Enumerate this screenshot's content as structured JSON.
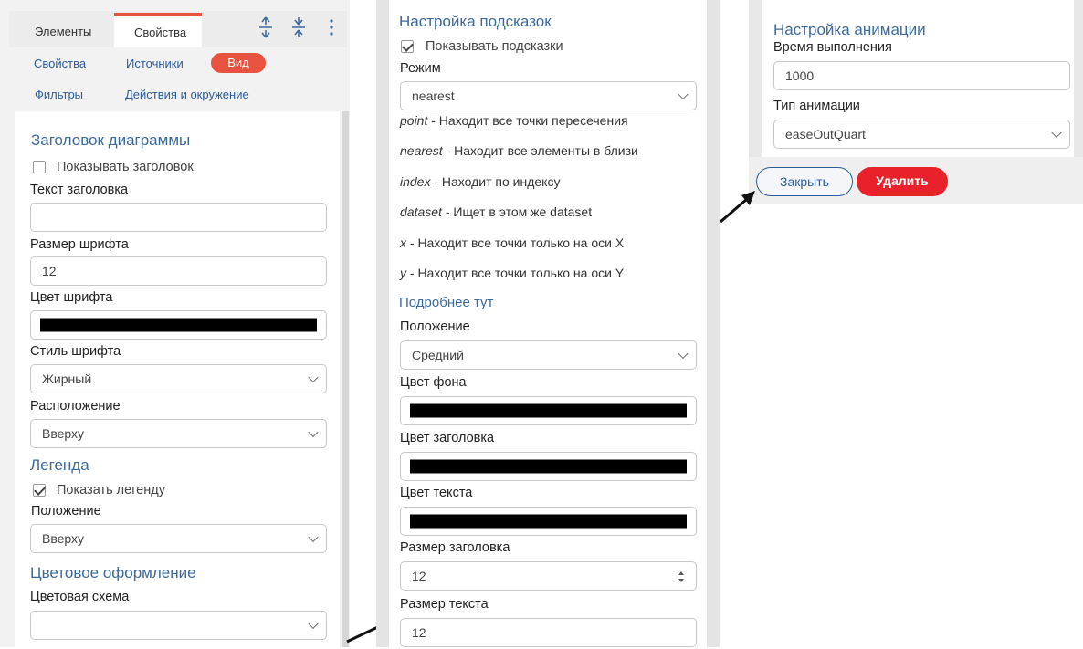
{
  "left_panel": {
    "tabs": [
      "Элементы",
      "Свойства"
    ],
    "subtabs": [
      "Свойства",
      "Источники",
      "Вид",
      "Фильтры",
      "Действия и окружение"
    ],
    "chart_title_section": "Заголовок диаграммы",
    "show_title_label": "Показывать заголовок",
    "show_title_checked": false,
    "title_text_label": "Текст заголовка",
    "title_text_value": "",
    "font_size_label": "Размер шрифта",
    "font_size_value": "12",
    "font_color_label": "Цвет шрифта",
    "font_color_value": "#000000",
    "font_style_label": "Стиль шрифта",
    "font_style_value": "Жирный",
    "position_label": "Расположение",
    "position_value": "Вверху",
    "legend_section": "Легенда",
    "show_legend_label": "Показать легенду",
    "show_legend_checked": true,
    "legend_position_label": "Положение",
    "legend_position_value": "Вверху",
    "color_section": "Цветовое оформление",
    "color_scheme_label": "Цветовая схема",
    "color_scheme_value": ""
  },
  "middle_panel": {
    "section": "Настройка подсказок",
    "show_tooltips_label": "Показывать подсказки",
    "show_tooltips_checked": true,
    "mode_label": "Режим",
    "mode_value": "nearest",
    "mode_desc": [
      {
        "key": "point",
        "text": " - Находит все точки пересечения"
      },
      {
        "key": "nearest",
        "text": " - Находит все элементы в близи"
      },
      {
        "key": "index",
        "text": " - Находит по индексу"
      },
      {
        "key": "dataset",
        "text": " - Ищет в этом же dataset"
      },
      {
        "key": "x",
        "text": " - Находит все точки только на оси X"
      },
      {
        "key": "y",
        "text": " - Находит все точки только на оси Y"
      }
    ],
    "more_link": "Подробнее тут",
    "position_label": "Положение",
    "position_value": "Средний",
    "bg_color_label": "Цвет фона",
    "title_color_label": "Цвет заголовка",
    "text_color_label": "Цвет текста",
    "title_size_label": "Размер заголовка",
    "title_size_value": "12",
    "text_size_label": "Размер текста",
    "text_size_value": "12"
  },
  "right_panel": {
    "section": "Настройка анимации",
    "duration_label": "Время выполнения",
    "duration_value": "1000",
    "anim_type_label": "Тип анимации",
    "anim_type_value": "easeOutQuart",
    "close_label": "Закрыть",
    "delete_label": "Удалить"
  },
  "colors": {
    "accent": "#e8533f",
    "delete": "#e8212b",
    "section": "#3d6a9c"
  }
}
